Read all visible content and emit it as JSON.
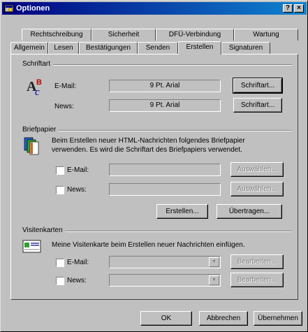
{
  "window": {
    "title": "Optionen",
    "help_button": "?",
    "close_button": "×"
  },
  "tabs": {
    "row_back": [
      "Rechtschreibung",
      "Sicherheit",
      "DFÜ-Verbindung",
      "Wartung"
    ],
    "row_front": [
      "Allgemein",
      "Lesen",
      "Bestätigungen",
      "Senden",
      "Erstellen",
      "Signaturen"
    ],
    "active": "Erstellen"
  },
  "schriftart": {
    "group_label": "Schriftart",
    "email_label": "E-Mail:",
    "email_value": "9 Pt. Arial",
    "email_button": "Schriftart...",
    "news_label": "News:",
    "news_value": "9 Pt. Arial",
    "news_button": "Schriftart..."
  },
  "briefpapier": {
    "group_label": "Briefpapier",
    "description_line1": "Beim Erstellen neuer HTML-Nachrichten folgendes Briefpapier",
    "description_line2": "verwenden. Es wird die Schriftart des Briefpapiers verwendet.",
    "email_label": "E-Mail:",
    "email_button": "Auswählen...",
    "news_label": "News:",
    "news_button": "Auswählen...",
    "create_button": "Erstellen...",
    "download_button": "Übertragen..."
  },
  "visitenkarten": {
    "group_label": "Visitenkarten",
    "description": "Meine Visitenkarte beim Erstellen neuer Nachrichten einfügen.",
    "email_label": "E-Mail:",
    "email_button": "Bearbeiten...",
    "news_label": "News:",
    "news_button": "Bearbeiten..."
  },
  "footer": {
    "ok": "OK",
    "cancel": "Abbrechen",
    "apply": "Übernehmen"
  },
  "colors": {
    "title_gradient_start": "#000080",
    "title_gradient_end": "#1084d0",
    "face": "#c0c0c0",
    "disabled_text": "#808080"
  },
  "icons": [
    "options-window-icon",
    "font-icon",
    "stationery-icon",
    "business-card-icon"
  ]
}
